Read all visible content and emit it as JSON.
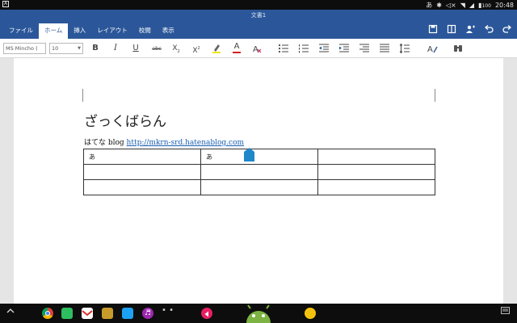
{
  "status_bar": {
    "left_icon": "A",
    "ime": "あ",
    "battery": "100",
    "time": "20:48"
  },
  "window": {
    "title": "文書1"
  },
  "tabs": [
    {
      "label": "ファイル",
      "active": false
    },
    {
      "label": "ホーム",
      "active": true
    },
    {
      "label": "挿入",
      "active": false
    },
    {
      "label": "レイアウト",
      "active": false
    },
    {
      "label": "校閲",
      "active": false
    },
    {
      "label": "表示",
      "active": false
    }
  ],
  "toolbar": {
    "font_name": "MS Mincho (",
    "font_size": "10",
    "bold": "B",
    "italic": "I",
    "underline": "U",
    "strike": "abc",
    "subscript": "X",
    "superscript": "X",
    "font_color_glyph": "A"
  },
  "document": {
    "heading": "ざっくばらん",
    "paragraph_text": "はてな blog ",
    "link": "http://mkrn-srd.hatenablog.com",
    "table": [
      [
        "あ",
        "あ",
        ""
      ],
      [
        "",
        "",
        ""
      ],
      [
        "",
        "",
        ""
      ]
    ]
  },
  "colors": {
    "ribbon": "#2b579a",
    "link": "#1a5fb4",
    "cursor_handle": "#1e88c9"
  },
  "icons": {
    "ribbon_actions": [
      "save-icon",
      "layout-icon",
      "share-icon",
      "undo-icon",
      "redo-icon"
    ],
    "taskbar": [
      "chrome-icon",
      "evernote-icon",
      "gmail-icon",
      "app-icon",
      "twitter-icon",
      "music-icon",
      "android-icon"
    ]
  }
}
